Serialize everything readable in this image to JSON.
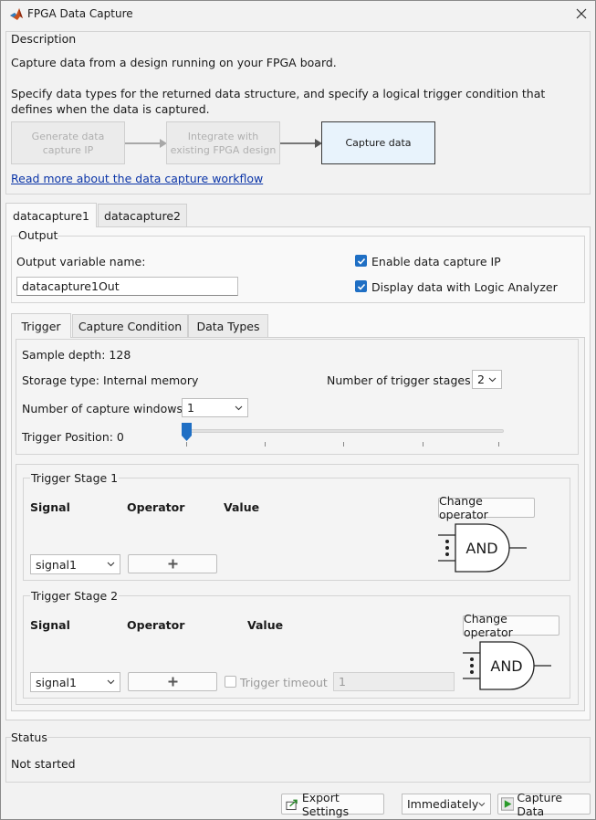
{
  "window": {
    "title": "FPGA Data Capture"
  },
  "description": {
    "title": "Description",
    "line1": "Capture data from a design running on your FPGA board.",
    "line2": "Specify data types for the returned data structure, and specify a logical trigger condition that defines when the data is captured.",
    "workflow": {
      "step1_line1": "Generate data",
      "step1_line2": "capture IP",
      "step2_line1": "Integrate with",
      "step2_line2": "existing FPGA design",
      "step3": "Capture data"
    },
    "link": "Read more about the data capture workflow"
  },
  "tabs": [
    {
      "label": "datacapture1"
    },
    {
      "label": "datacapture2"
    }
  ],
  "output": {
    "title": "Output",
    "var_label": "Output variable name:",
    "var_value": "datacapture1Out",
    "enable_ip": "Enable data capture IP",
    "display_la": "Display data with Logic Analyzer"
  },
  "inner_tabs": [
    {
      "label": "Trigger"
    },
    {
      "label": "Capture Condition"
    },
    {
      "label": "Data Types"
    }
  ],
  "trigger": {
    "sample_depth": "Sample depth: 128",
    "storage_type": "Storage type: Internal memory",
    "num_stages_label": "Number of trigger stages:",
    "num_stages_value": "2",
    "num_windows_label": "Number of capture windows:",
    "num_windows_value": "1",
    "position_label": "Trigger Position: 0",
    "position_fraction": 0
  },
  "stage1": {
    "title": "Trigger Stage 1",
    "signal_header": "Signal",
    "operator_header": "Operator",
    "value_header": "Value",
    "change_operator": "Change operator",
    "gate": "AND",
    "signal_value": "signal1"
  },
  "stage2": {
    "title": "Trigger Stage 2",
    "signal_header": "Signal",
    "operator_header": "Operator",
    "value_header": "Value",
    "change_operator": "Change operator",
    "gate": "AND",
    "signal_value": "signal1",
    "timeout_label": "Trigger timeout",
    "timeout_value": "1"
  },
  "status": {
    "title": "Status",
    "value": "Not started"
  },
  "footer": {
    "export": "Export Settings",
    "mode": "Immediately",
    "capture": "Capture Data"
  },
  "colors": {
    "accent": "#1f6fc4",
    "link": "#0b35a8",
    "active_step": "#e8f3fc"
  }
}
